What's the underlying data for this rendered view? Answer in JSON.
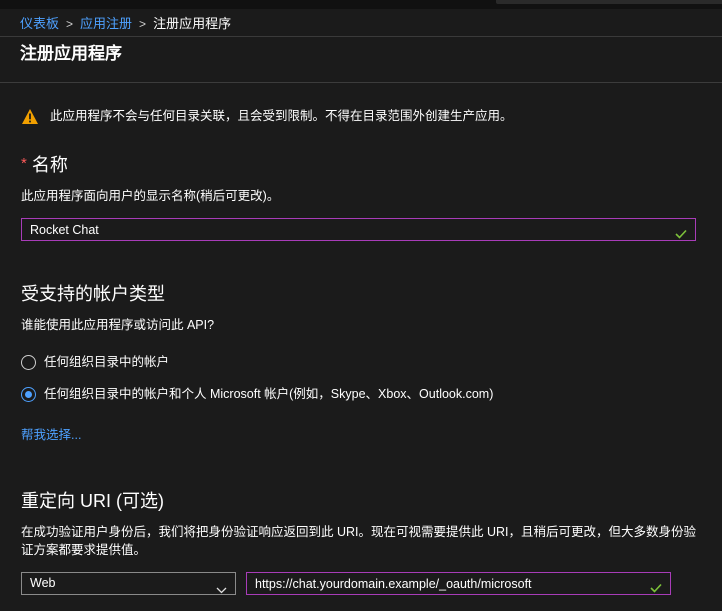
{
  "breadcrumb": {
    "items": [
      "仪表板",
      "应用注册"
    ],
    "current": "注册应用程序",
    "separator": ">"
  },
  "page": {
    "title": "注册应用程序"
  },
  "warning": {
    "icon": "warning-icon",
    "text": "此应用程序不会与任何目录关联，且会受到限制。不得在目录范围外创建生产应用。"
  },
  "name_section": {
    "required_mark": "*",
    "label": "名称",
    "description": "此应用程序面向用户的显示名称(稍后可更改)。",
    "input_value": "Rocket Chat"
  },
  "account_types": {
    "label": "受支持的帐户类型",
    "question": "谁能使用此应用程序或访问此 API?",
    "options": [
      {
        "label": "任何组织目录中的帐户",
        "selected": false
      },
      {
        "label": "任何组织目录中的帐户和个人 Microsoft 帐户(例如，Skype、Xbox、Outlook.com)",
        "selected": true
      }
    ],
    "help_link": "帮我选择..."
  },
  "redirect": {
    "label": "重定向 URI (可选)",
    "description": "在成功验证用户身份后，我们将把身份验证响应返回到此 URI。现在可视需要提供此 URI，且稍后可更改，但大多数身份验证方案都要求提供值。",
    "platform_value": "Web",
    "uri_value": "https://chat.yourdomain.example/_oauth/microsoft"
  },
  "colors": {
    "background": "#1b1b1b",
    "link": "#4ea1ff",
    "input_border_active": "#a83cb8",
    "valid_check": "#7dc23a",
    "warning": "#f2a000",
    "required": "#ff5a5a"
  }
}
